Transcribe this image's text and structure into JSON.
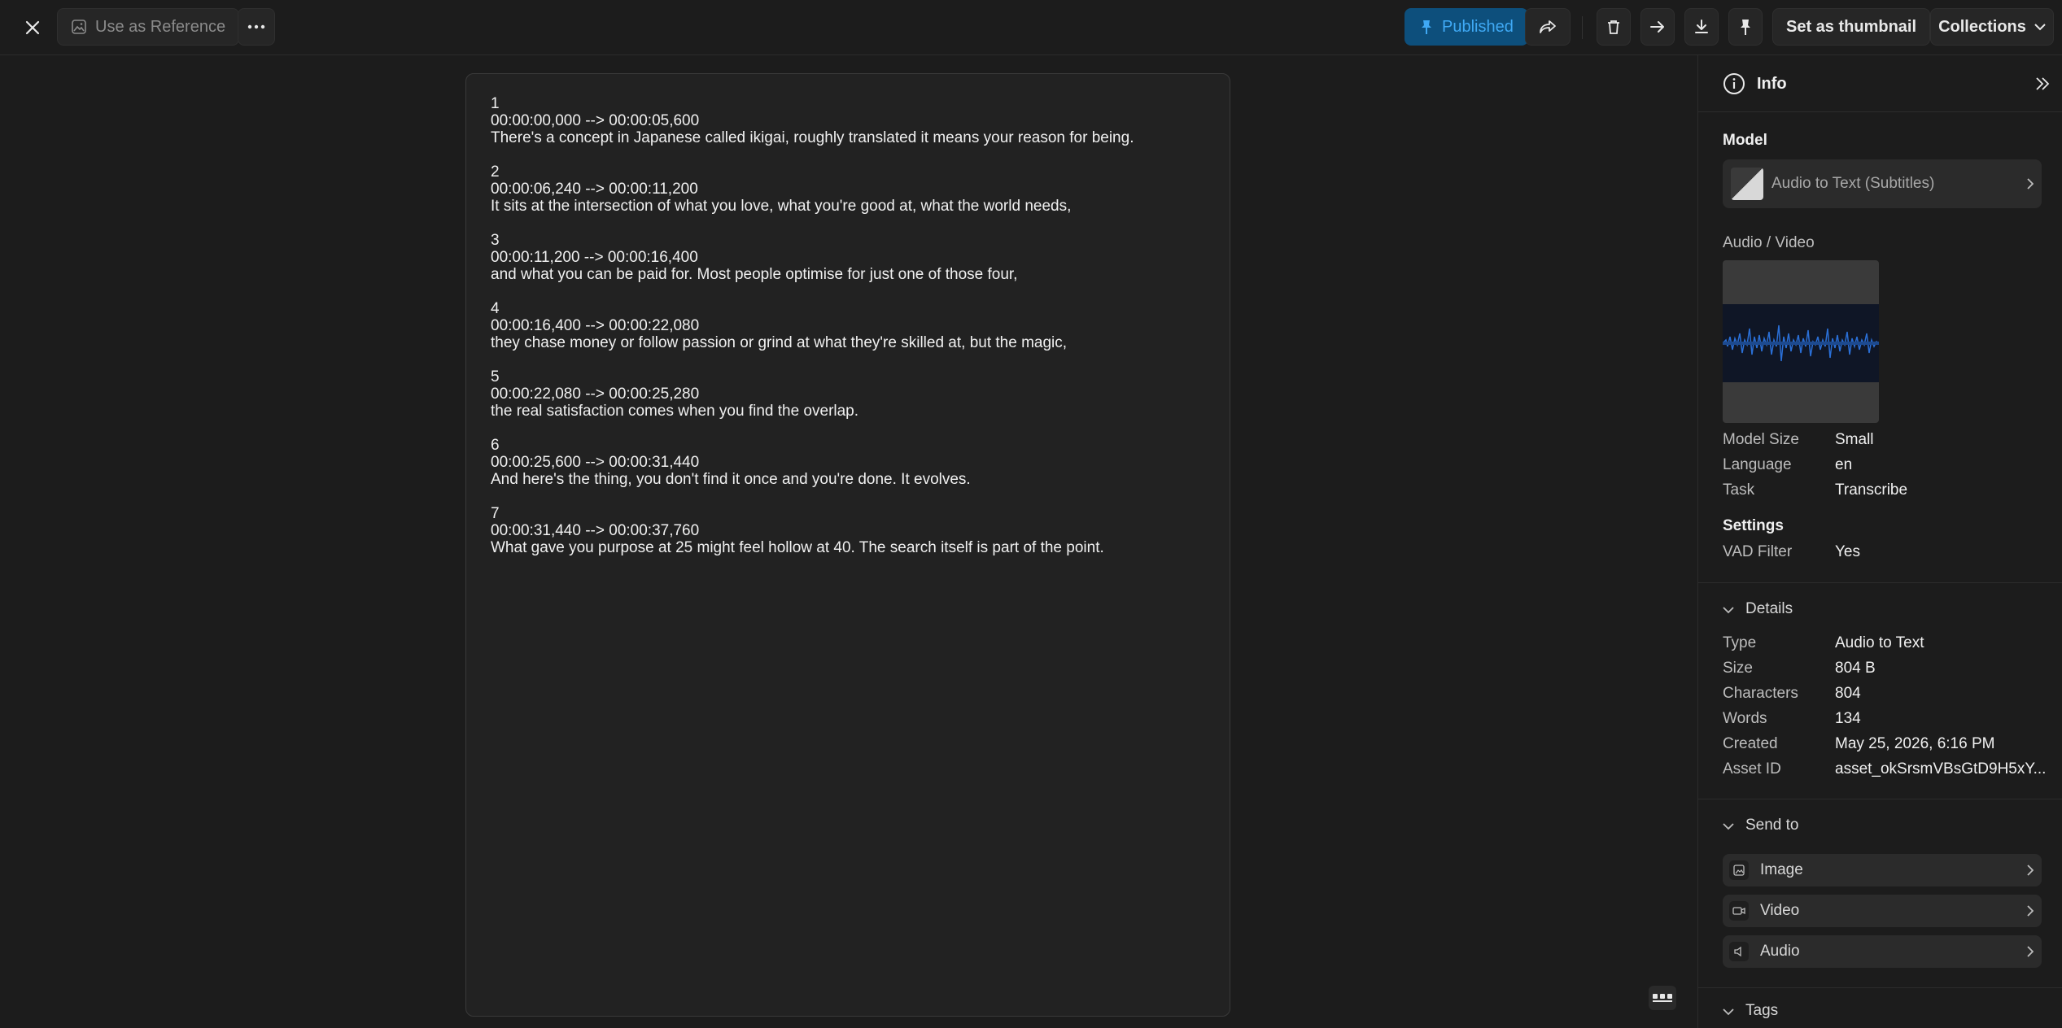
{
  "toolbar": {
    "use_reference_label": "Use as Reference",
    "published_label": "Published",
    "thumbnail_label": "Set as thumbnail",
    "collections_label": "Collections"
  },
  "subtitles": [
    {
      "index": "1",
      "time": "00:00:00,000 --> 00:00:05,600",
      "text": "There's a concept in Japanese called ikigai, roughly translated it means your reason for being."
    },
    {
      "index": "2",
      "time": "00:00:06,240 --> 00:00:11,200",
      "text": "It sits at the intersection of what you love, what you're good at, what the world needs,"
    },
    {
      "index": "3",
      "time": "00:00:11,200 --> 00:00:16,400",
      "text": "and what you can be paid for. Most people optimise for just one of those four,"
    },
    {
      "index": "4",
      "time": "00:00:16,400 --> 00:00:22,080",
      "text": "they chase money or follow passion or grind at what they're skilled at, but the magic,"
    },
    {
      "index": "5",
      "time": "00:00:22,080 --> 00:00:25,280",
      "text": "the real satisfaction comes when you find the overlap."
    },
    {
      "index": "6",
      "time": "00:00:25,600 --> 00:00:31,440",
      "text": "And here's the thing, you don't find it once and you're done. It evolves."
    },
    {
      "index": "7",
      "time": "00:00:31,440 --> 00:00:37,760",
      "text": "What gave you purpose at 25 might feel hollow at 40. The search itself is part of the point."
    }
  ],
  "panel": {
    "title": "Info",
    "model_heading": "Model",
    "model_name": "Audio to Text (Subtitles)",
    "media_heading": "Audio / Video",
    "params": [
      {
        "label": "Model Size",
        "value": "Small"
      },
      {
        "label": "Language",
        "value": "en"
      },
      {
        "label": "Task",
        "value": "Transcribe"
      }
    ],
    "settings_heading": "Settings",
    "settings": [
      {
        "label": "VAD Filter",
        "value": "Yes"
      }
    ],
    "details_heading": "Details",
    "details": [
      {
        "label": "Type",
        "value": "Audio to Text"
      },
      {
        "label": "Size",
        "value": "804 B"
      },
      {
        "label": "Characters",
        "value": "804"
      },
      {
        "label": "Words",
        "value": "134"
      },
      {
        "label": "Created",
        "value": "May 25, 2026, 6:16 PM"
      },
      {
        "label": "Asset ID",
        "value": "asset_okSrsmVBsGtD9H5xY..."
      }
    ],
    "send_heading": "Send to",
    "send_items": [
      "Image",
      "Video",
      "Audio"
    ],
    "tags_heading": "Tags"
  },
  "colors": {
    "background": "#1c1c1c",
    "published_bg": "#0d4f7c",
    "published_text": "#3fa9f5",
    "waveform": "#2a6fd6"
  }
}
